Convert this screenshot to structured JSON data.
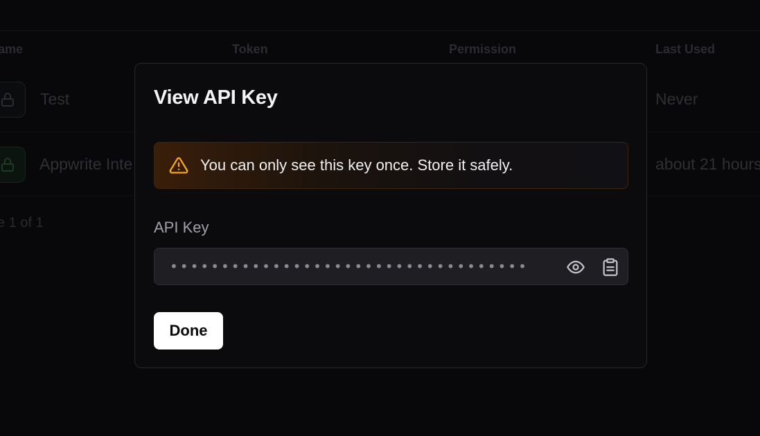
{
  "table": {
    "headers": {
      "name": "ame",
      "token": "Token",
      "permission": "Permission",
      "last_used": "Last Used"
    },
    "rows": [
      {
        "name": "Test",
        "last_used": "Never",
        "icon": "lock-icon"
      },
      {
        "name": "Appwrite Inte",
        "last_used": "about 21 hours",
        "icon": "lock-icon"
      }
    ],
    "pagination": "e 1 of 1"
  },
  "modal": {
    "title": "View API Key",
    "alert": {
      "icon": "warning-triangle-icon",
      "text": "You can only see this key once. Store it safely.",
      "color": "#f5a623"
    },
    "field": {
      "label": "API Key",
      "masked_value": "••••••••••••••••••••••••••••••••••••",
      "reveal_icon": "eye-icon",
      "copy_icon": "clipboard-icon"
    },
    "done_label": "Done"
  },
  "colors": {
    "background": "#08080a",
    "modal_bg": "#0b0b0e",
    "warning": "#f5a623",
    "primary_button_bg": "#ffffff"
  }
}
